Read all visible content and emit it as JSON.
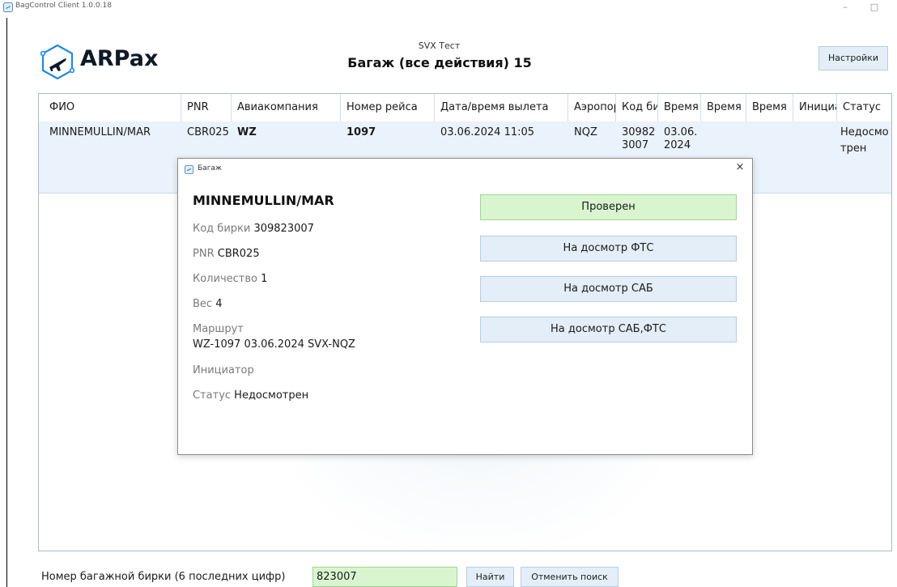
{
  "window": {
    "title": "BagControl Client 1.0.0.18",
    "minimize_glyph": "–",
    "maximize_glyph": "□"
  },
  "header": {
    "logo_text": "ARPax",
    "station": "SVX Тест",
    "title": "Багаж (все действия) 15",
    "settings_label": "Настройки"
  },
  "grid": {
    "columns": [
      "ФИО",
      "PNR",
      "Авиакомпания",
      "Номер рейса",
      "Дата/время вылета",
      "Аэропорт",
      "Код бирки",
      "Время",
      "Время",
      "Время",
      "Инициатор",
      "Статус"
    ],
    "rows": [
      {
        "name": "MINNEMULLIN/MAR",
        "pnr": "CBR025",
        "airline": "WZ",
        "flight": "1097",
        "departure": "03.06.2024 11:05",
        "airport": "NQZ",
        "tag": "309823007",
        "time1": "03.06.2024",
        "time2": "",
        "time3": "",
        "initiator": "",
        "status": "Недосмотрен"
      }
    ]
  },
  "dialog": {
    "title": "Багаж",
    "close_glyph": "×",
    "passenger": "MINNEMULLIN/MAR",
    "tag_label": "Код бирки",
    "tag_value": "309823007",
    "pnr_label": "PNR",
    "pnr_value": "CBR025",
    "qty_label": "Количество",
    "qty_value": "1",
    "weight_label": "Вес",
    "weight_value": "4",
    "route_label": "Маршрут",
    "route_value": "WZ-1097  03.06.2024  SVX-NQZ",
    "initiator_label": "Инициатор",
    "status_label": "Статус",
    "status_value": "Недосмотрен",
    "buttons": {
      "checked": "Проверен",
      "fts": "На досмотр ФТС",
      "sab": "На досмотр САБ",
      "sab_fts": "На досмотр САБ,ФТС"
    }
  },
  "search": {
    "label": "Номер багажной бирки (6 последних цифр)",
    "value": "823007",
    "find_label": "Найти",
    "cancel_label": "Отменить поиск"
  },
  "colors": {
    "accent_green": "#d8f5d0",
    "button_blue": "#e3eef8",
    "row_selected": "#eaf2fb",
    "logo_blue": "#1e88e5"
  },
  "icons": [
    "app-icon",
    "plane-logo-icon",
    "close-icon"
  ]
}
